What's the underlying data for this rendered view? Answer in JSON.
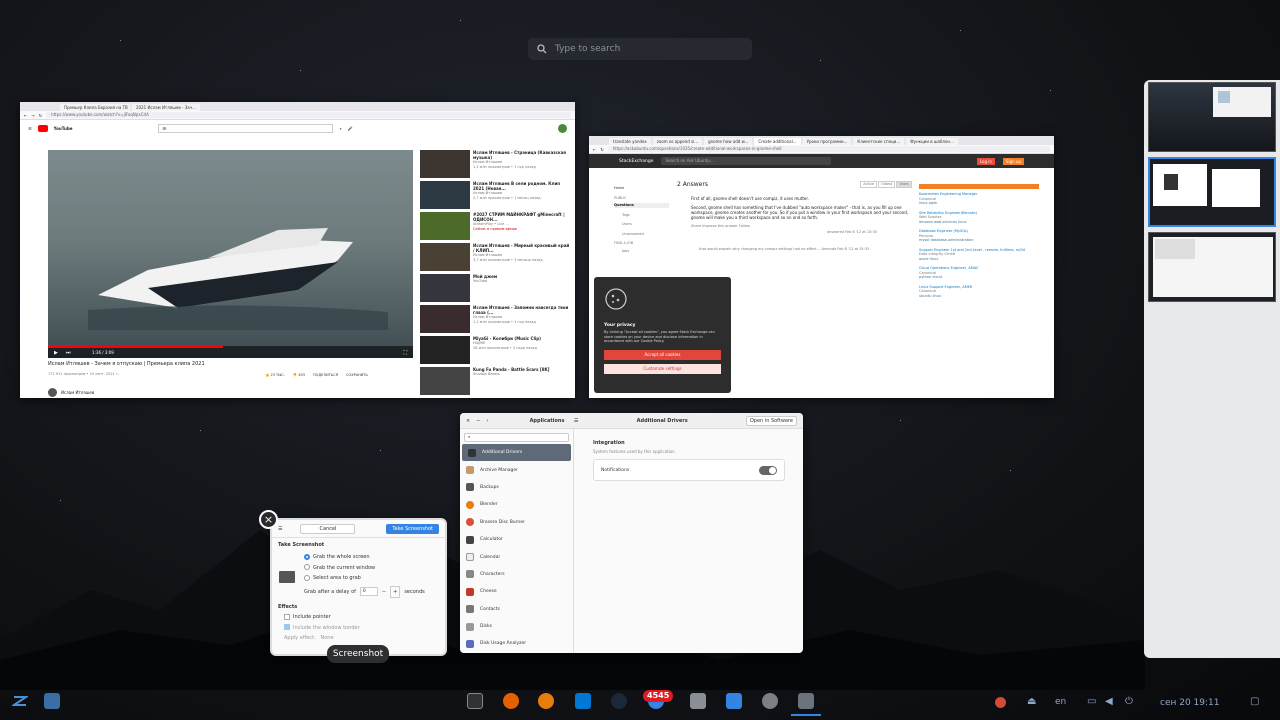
{
  "search": {
    "placeholder": "Type to search",
    "icon": "search-icon"
  },
  "youtube_window": {
    "tabs": [
      "Премьер Клипа Евразия на ТВ",
      "2021 Ислам Итляшев - Зач..."
    ],
    "url": "https://www.youtube.com/watch?v=jIFaqNpxCdA",
    "search_value": "m",
    "logo": "YouTube",
    "player_time": "1:36 / 3:09",
    "video_title": "Ислам Итляшев - Зачем я отпускаю | Премьера клипа 2021",
    "video_stats": "772 911 просмотров • 10 сент. 2021 г.",
    "likes": "23 ТЫС.",
    "dislikes": "493",
    "share": "ПОДЕЛИТЬСЯ",
    "save": "СОХРАНИТЬ",
    "channel": "Ислам Итляшев",
    "sidebar": [
      {
        "title": "Ислам Итляшев - Страница (Кавказская музыка)",
        "channel": "Ислам Итляшев",
        "meta": "1,2 млн просмотров • 1 год назад",
        "duration": "2:58"
      },
      {
        "title": "Ислам Итляшев В сели родном. Клип 2021 (Новая...",
        "channel": "Ислам Итляшев",
        "meta": "2,7 млн просмотров • 1 месяц назад",
        "duration": "3:01"
      },
      {
        "title": "#2027 СТРИМ МАЙНКРАФТ gMinecraft | ОДИСОН...",
        "channel": "StreamPlay • Live ...",
        "meta": "Сейчас в прямом эфире",
        "duration": ""
      },
      {
        "title": "Ислам Итляшев - Мирный красивый край / КЛИП...",
        "channel": "Ислам Итляшев",
        "meta": "3,7 млн просмотров • 3 месяца назад",
        "duration": "3:21"
      },
      {
        "title": "Мой джем",
        "channel": "YouTube",
        "meta": "",
        "duration": ""
      },
      {
        "title": "Ислам Итляшев - Запомни навсегда твои глаза (...",
        "channel": "Ислам Итляшев",
        "meta": "1,1 млн просмотров • 1 год назад",
        "duration": "3:30"
      },
      {
        "title": "MiyaGi - Колибри (Music Clip)",
        "channel": "HAJIME",
        "meta": "18 млн просмотров • 2 года назад",
        "duration": "3:33"
      },
      {
        "title": "Kung Fu Panda - Battle Scars [8K]",
        "channel": "Shadow Beasts",
        "meta": "1,2 млн просмотров • 1 год назад",
        "duration": "4:01"
      }
    ]
  },
  "askubuntu_window": {
    "tabs": [
      "translate yandex",
      "zoom os append si...",
      "gnome how add w...",
      "Create additional...",
      "Уроки программи...",
      "Клиентские специ...",
      "Функции в шаблон..."
    ],
    "url": "https://askubuntu.com/questions/1035/create-additional-workspaces-in-gnome-shell",
    "site_search": "Search on Ask Ubuntu...",
    "login": "Log in",
    "signup": "Sign up",
    "answers_heading": "2 Answers",
    "sort_buttons": [
      "Active",
      "Oldest",
      "Votes"
    ],
    "nav": [
      "Home",
      "PUBLIC",
      "Questions",
      "Tags",
      "Users",
      "Unanswered",
      "FIND A JOB",
      "Jobs"
    ],
    "answer_text_1": "First of all, gnome shell doesn't use compiz, it uses mutter.",
    "answer_text_2": "Second, gnome shell has something that I've dubbed \"auto workspace maker\" - that is, as you fill up one workspace, gnome creates another for you. So if you put a window in your first workspace and your second, gnome will make you a third workspace and so on and so forth.",
    "answer_actions": "Share  Improve this answer  Follow",
    "answered": "answered Feb 8 '12 at 15:30",
    "comment_1": "that would explain why changing my compiz settings had no effect. – Amanda Feb 8 '12 at 15:33",
    "privacy": {
      "title": "Your privacy",
      "text": "By clicking \"Accept all cookies\", you agree Stack Exchange can store cookies on your device and disclose information in accordance with our Cookie Policy.",
      "accept": "Accept all cookies",
      "customize": "Customize settings"
    },
    "jobs": [
      {
        "title": "Kubernetes Engineering Manager",
        "company": "Canonical",
        "tags": "linux  agile"
      },
      {
        "title": "Site Reliability Engineer(Remote)",
        "company": "Web Scoutec",
        "tags": "amazon-web-services  linux"
      },
      {
        "title": "Database Engineer (MySQL)",
        "company": "Percona",
        "tags": "mysql  database-administration"
      },
      {
        "title": "Support Engineer 1st and 2nd Level - remote, fulltime, m/f/d",
        "company": "Data Integrity GmbH",
        "tags": "azure  linux"
      },
      {
        "title": "Cloud Operations Engineer, AMAC",
        "company": "Canonical",
        "tags": "python  cloud"
      },
      {
        "title": "Linux Support Engineer, AMER",
        "company": "Canonical",
        "tags": "ubuntu  linux"
      }
    ]
  },
  "settings_window": {
    "sidebar_title": "Applications",
    "page_title": "Additional Drivers",
    "open_button": "Open in Software",
    "items": [
      "Additional Drivers",
      "Archive Manager",
      "Backups",
      "Blender",
      "Brasero Disc Burner",
      "Calculator",
      "Calendar",
      "Characters",
      "Cheese",
      "Contacts",
      "Disks",
      "Disk Usage Analyzer"
    ],
    "section_title": "Integration",
    "section_sub": "System features used by this application",
    "notifications_label": "Notifications",
    "notifications_on": true
  },
  "screenshot_dialog": {
    "cancel": "Cancel",
    "take": "Take Screenshot",
    "section_take": "Take Screenshot",
    "grab_whole": "Grab the whole screen",
    "grab_window": "Grab the current window",
    "grab_area": "Select area to grab",
    "delay_label": "Grab after a delay of",
    "delay_value": "0",
    "delay_unit": "seconds",
    "section_effects": "Effects",
    "include_pointer": "Include pointer",
    "include_border": "Include the window border",
    "apply_effect": "Apply effect:",
    "effect_value": "None",
    "tooltip": "Screenshot"
  },
  "taskbar": {
    "badge": "4545",
    "lang": "en",
    "clock": "сен 20  19:11"
  },
  "colors": {
    "accent": "#3584e4",
    "youtube_red": "#ff0000",
    "so_orange": "#f48024",
    "badge": "#e01b24"
  }
}
